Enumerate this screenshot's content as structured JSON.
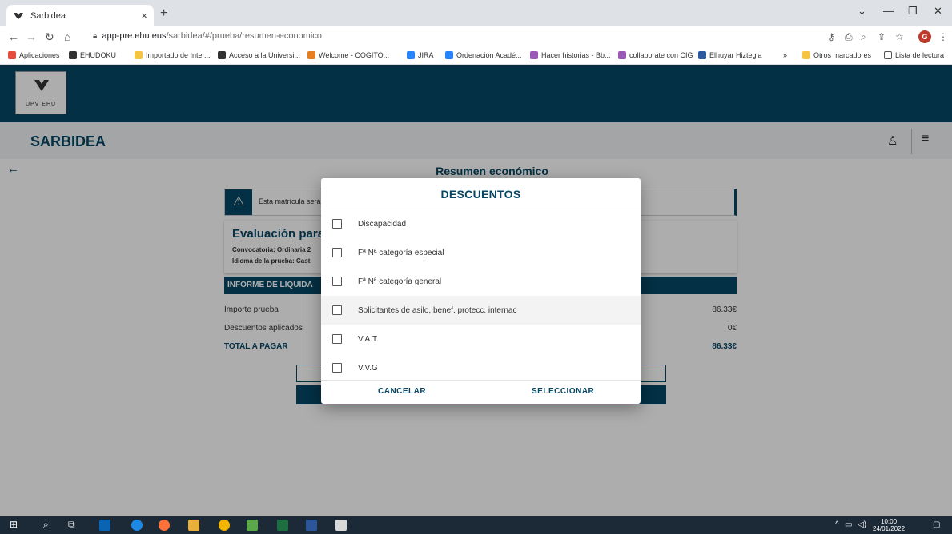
{
  "browser": {
    "tab_title": "Sarbidea",
    "tab_close": "×",
    "new_tab": "+",
    "url_host": "app-pre.ehu.eus",
    "url_path": "/sarbidea/#/prueba/resumen-economico",
    "bookmarks": [
      {
        "label": "Aplicaciones",
        "color": "#e74c3c"
      },
      {
        "label": "EHUDOKU",
        "color": "#333"
      },
      {
        "label": "Importado de Inter...",
        "color": "#f5c542"
      },
      {
        "label": "Acceso a la Universi...",
        "color": "#333"
      },
      {
        "label": "Welcome - COGITO...",
        "color": "#e67e22"
      },
      {
        "label": "JIRA",
        "color": "#2684ff"
      },
      {
        "label": "Ordenación Acadé...",
        "color": "#2684ff"
      },
      {
        "label": "Hacer historias - Bb...",
        "color": "#9b59b6"
      },
      {
        "label": "collaborate con CIG",
        "color": "#9b59b6"
      },
      {
        "label": "Elhuyar Hiztegia",
        "color": "#2c5aa0"
      }
    ],
    "bookmarks_more": "»",
    "other_bookmarks": "Otros marcadores",
    "reading_list": "Lista de lectura",
    "profile_initial": "G"
  },
  "header": {
    "logo_text": "UPV  EHU",
    "brand": "SARBIDEA"
  },
  "page": {
    "title": "Resumen económico",
    "alert_text": "Esta matrícula será",
    "eval_title": "Evaluación para",
    "convocatoria": "Convocatoria: Ordinaria 2",
    "idioma": "Idioma de la prueba: Cast",
    "informe_header": "INFORME DE LIQUIDA",
    "rows": [
      {
        "label": "Importe prueba",
        "value": "86.33€"
      },
      {
        "label": "Descuentos aplicados",
        "value": "0€"
      }
    ],
    "total": {
      "label": "TOTAL A PAGAR",
      "value": "86.33€"
    }
  },
  "dialog": {
    "title": "DESCUENTOS",
    "options": [
      {
        "label": "Discapacidad",
        "checked": false
      },
      {
        "label": "Fª Nª categoría especial",
        "checked": false
      },
      {
        "label": "Fª Nª categoría general",
        "checked": false
      },
      {
        "label": "Solicitantes de asilo, benef. protecc. internac",
        "checked": false
      },
      {
        "label": "V.A.T.",
        "checked": false
      },
      {
        "label": "V.V.G",
        "checked": false
      }
    ],
    "cancel_label": "CANCELAR",
    "select_label": "SELECCIONAR"
  },
  "taskbar": {
    "time": "10:00",
    "date": "24/01/2022"
  },
  "colors": {
    "brand_dark": "#054765",
    "overlay": "rgba(0,0,0,0.32)"
  }
}
